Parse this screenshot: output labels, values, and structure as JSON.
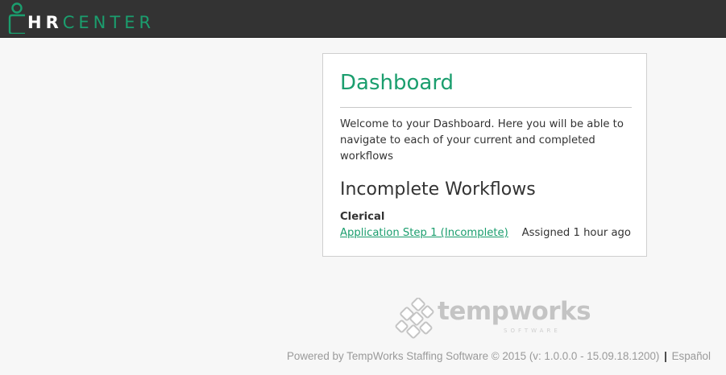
{
  "header": {
    "logo_hr": "HR",
    "logo_center": "CENTER",
    "brand_color": "#1b9e6e",
    "bar_color": "#333333"
  },
  "dashboard": {
    "title": "Dashboard",
    "intro": "Welcome to your Dashboard. Here you will be able to navigate to each of your current and completed workflows",
    "incomplete_section_title": "Incomplete Workflows",
    "workflows": [
      {
        "group": "Clerical",
        "link_label": "Application Step 1 (Incomplete)",
        "assigned": "Assigned 1 hour ago"
      }
    ]
  },
  "branding": {
    "wordmark": "tempworks",
    "tagline": "SOFTWARE",
    "icon": "tempworks-cubes-icon"
  },
  "footer": {
    "powered_by": "Powered by TempWorks Staffing Software © 2015 (v: 1.0.0.0 - 15.09.18.1200)",
    "separator": "|",
    "language_link": "Español"
  }
}
